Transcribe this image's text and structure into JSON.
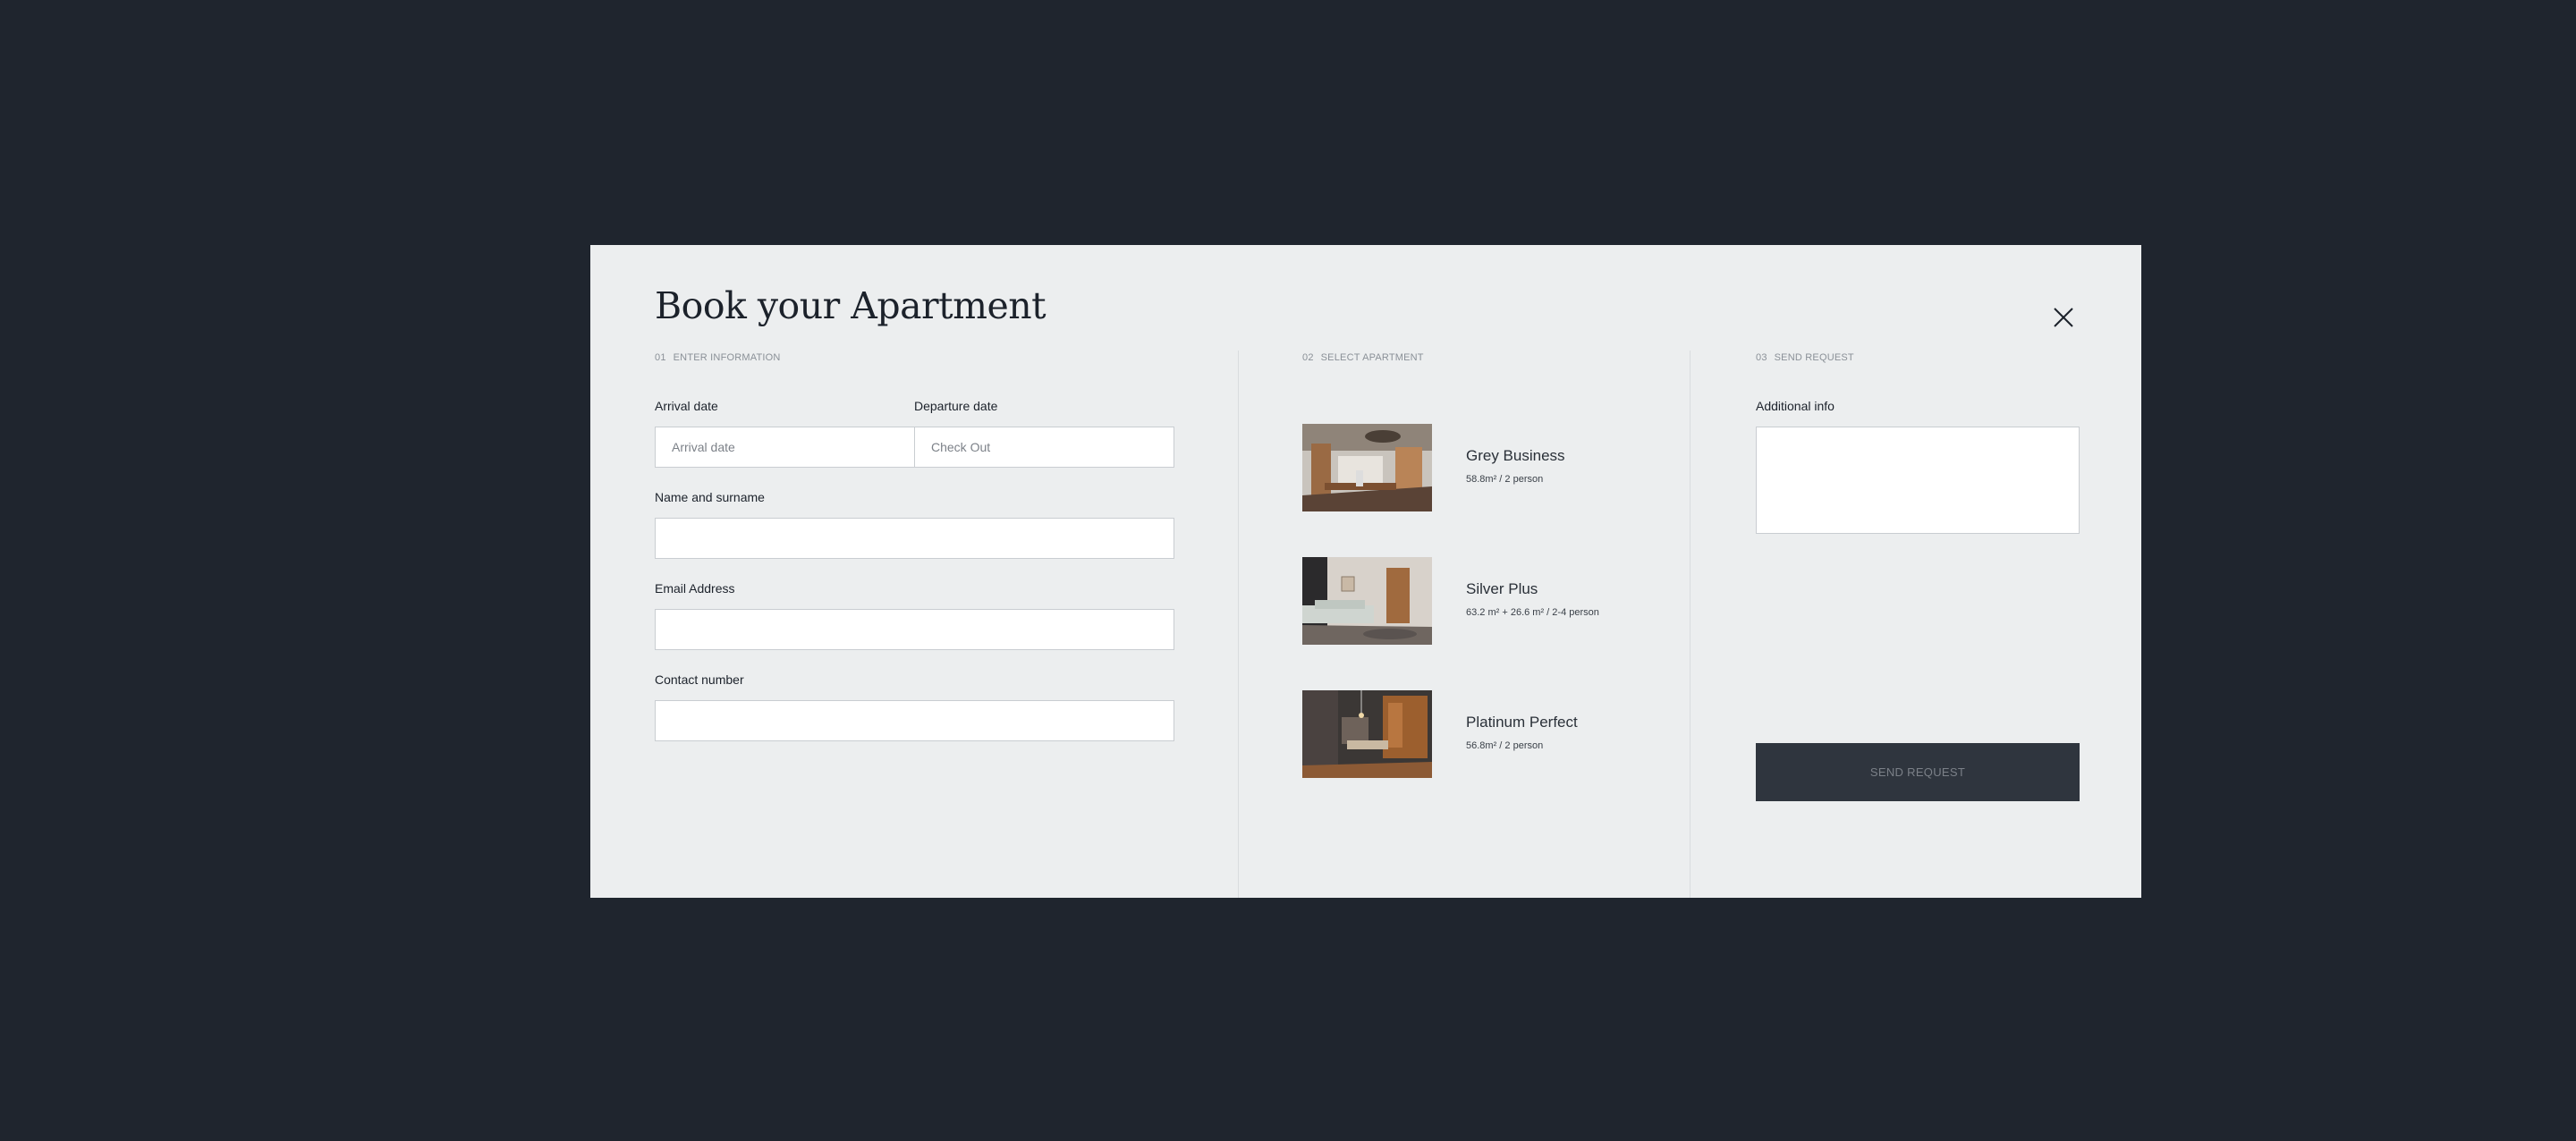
{
  "modal": {
    "title": "Book your Apartment"
  },
  "steps": [
    {
      "num": "01",
      "label": "ENTER INFORMATION"
    },
    {
      "num": "02",
      "label": "SELECT APARTMENT"
    },
    {
      "num": "03",
      "label": "SEND REQUEST"
    }
  ],
  "form": {
    "arrival_label": "Arrival date",
    "arrival_placeholder": "Arrival date",
    "departure_label": "Departure date",
    "departure_placeholder": "Check Out",
    "name_label": "Name and surname",
    "email_label": "Email Address",
    "contact_label": "Contact number",
    "additional_label": "Additional info",
    "send_label": "SEND REQUEST"
  },
  "apartments": [
    {
      "name": "Grey Business",
      "spec": "58.8m² / 2 person"
    },
    {
      "name": "Silver Plus",
      "spec": "63.2 m² + 26.6 m² / 2-4 person"
    },
    {
      "name": "Platinum Perfect",
      "spec": "56.8m² / 2 person"
    }
  ],
  "icons": {
    "close": "close-icon"
  }
}
